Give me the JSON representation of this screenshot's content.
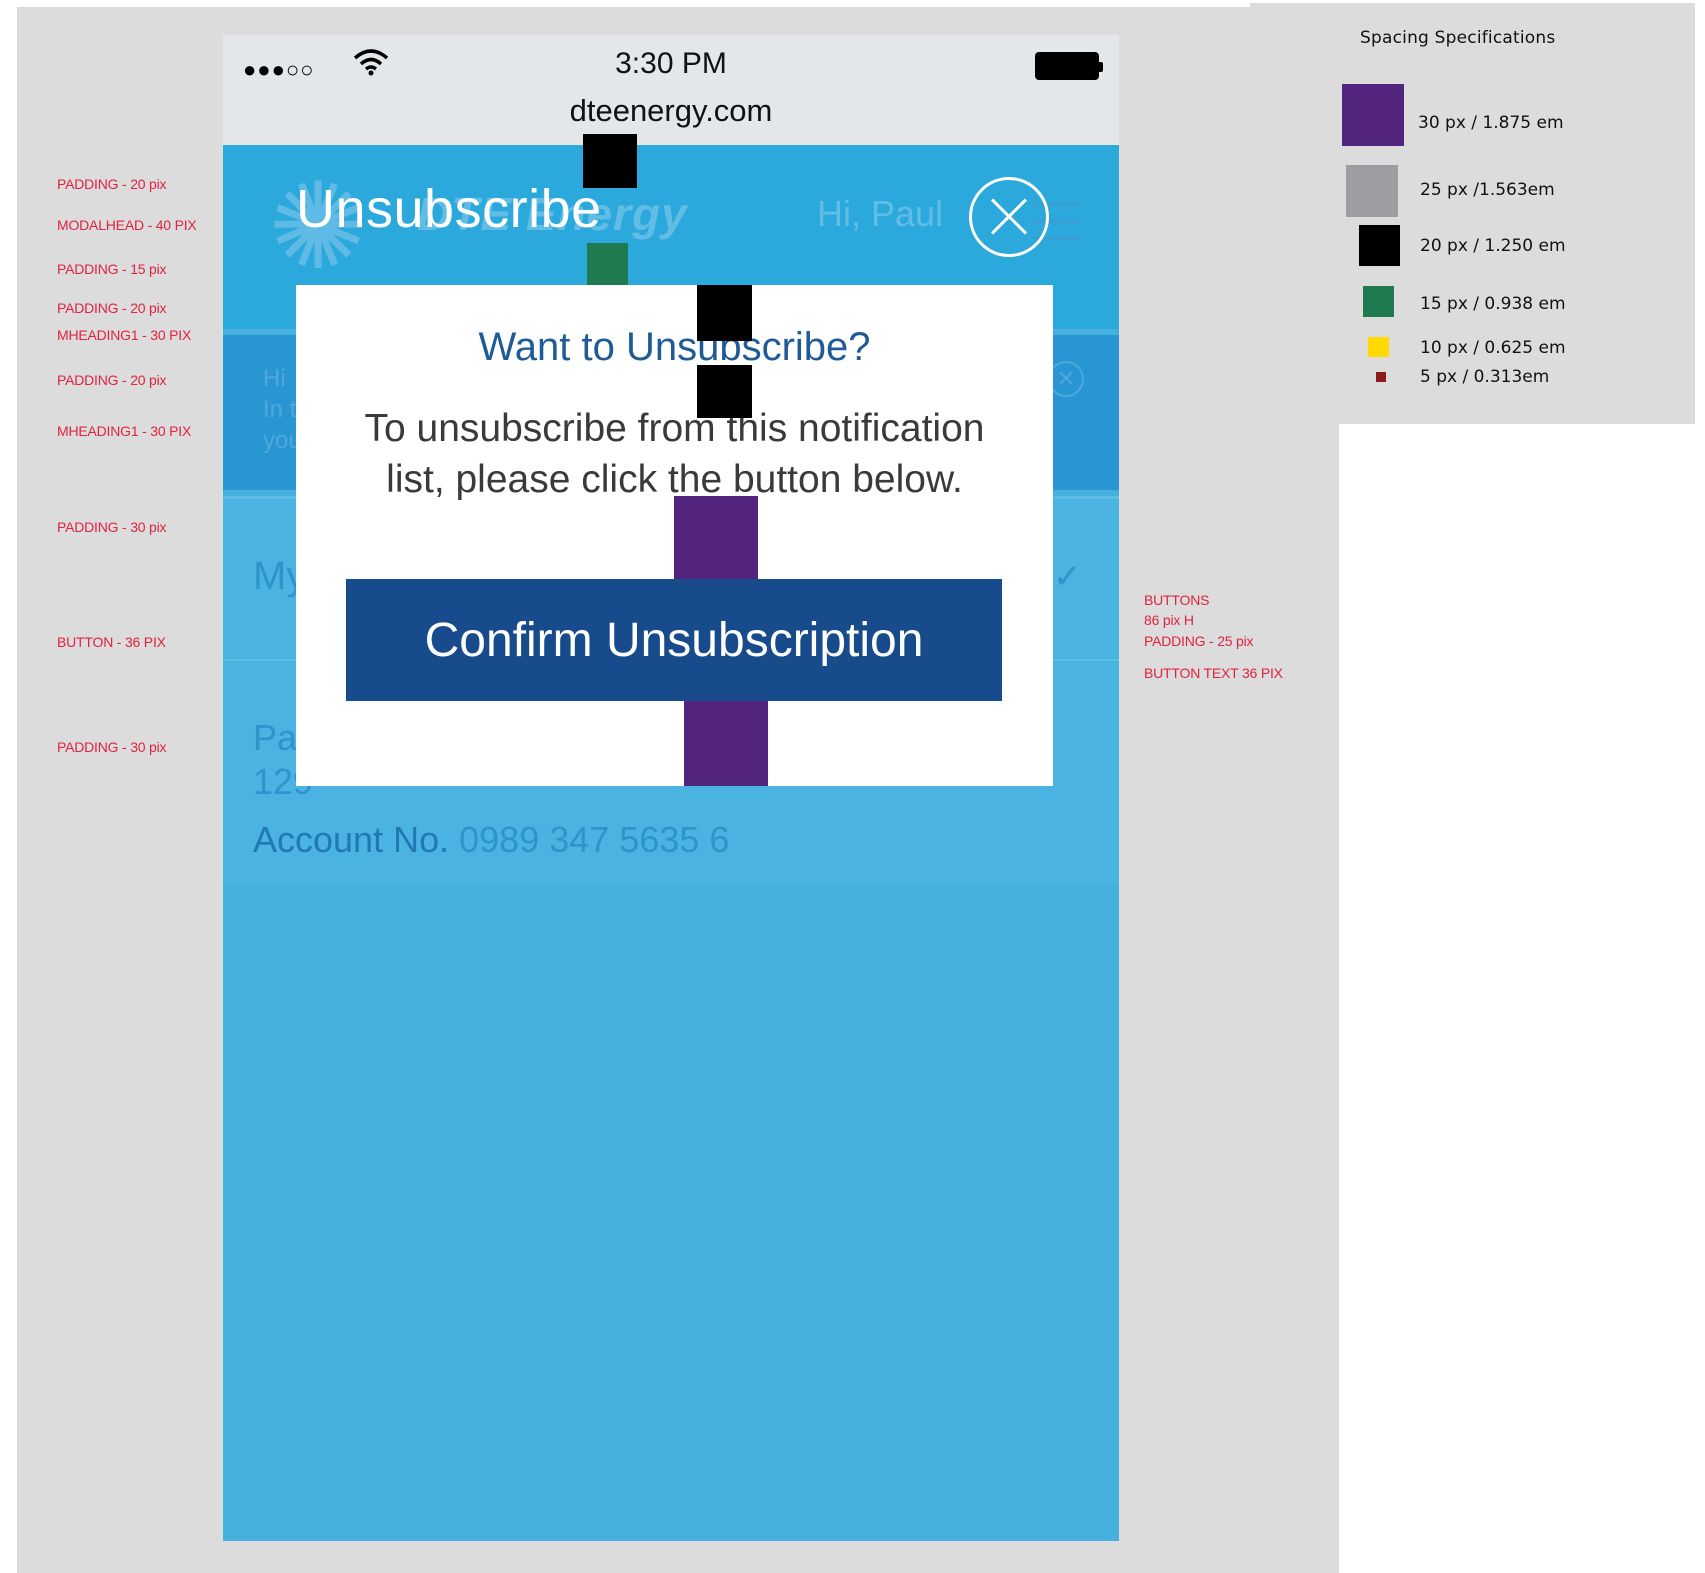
{
  "status_bar": {
    "signal": "●●●○○",
    "time": "3:30 PM",
    "url": "dteenergy.com"
  },
  "app_header": {
    "logo_text": "DTE Energy",
    "greeting": "Hi, Paul"
  },
  "banner": {
    "lines": [
      "Hi",
      "In t",
      "you"
    ]
  },
  "section": {
    "title_fragment": "My"
  },
  "account": {
    "name_fragment": "Pa",
    "address_fragment": "129",
    "number_label": "Account No.",
    "number_value": "0989 347 5635 6"
  },
  "modal": {
    "title": "Unsubscribe",
    "heading": "Want to Unsubscribe?",
    "body_line1": "To unsubscribe from this notification",
    "body_line2": "list, please click the button below.",
    "confirm_label": "Confirm Unsubscription"
  },
  "annotations_left": [
    "PADDING - 20 pix",
    "MODALHEAD - 40 PIX",
    "PADDING - 15 pix",
    "PADDING - 20 pix",
    "MHEADING1 - 30 PIX",
    "PADDING - 20 pix",
    "MHEADING1 - 30 PIX",
    "PADDING - 30 pix",
    "BUTTON - 36 PIX",
    "PADDING - 30 pix"
  ],
  "annotations_right": [
    "BUTTONS",
    "86  pix H",
    "PADDING - 25 pix",
    "BUTTON TEXT 36 PIX"
  ],
  "spec": {
    "title": "Spacing Specifications",
    "items": [
      {
        "label": "30 px / 1.875 em",
        "color": "#52247e"
      },
      {
        "label": "25 px /1.563em",
        "color": "#9d9da1"
      },
      {
        "label": "20 px / 1.250 em",
        "color": "#000000"
      },
      {
        "label": "15 px /  0.938 em",
        "color": "#207a50"
      },
      {
        "label": "10 px / 0.625 em",
        "color": "#ffd900"
      },
      {
        "label": "5 px / 0.313em",
        "color": "#8b1a1a"
      }
    ]
  }
}
